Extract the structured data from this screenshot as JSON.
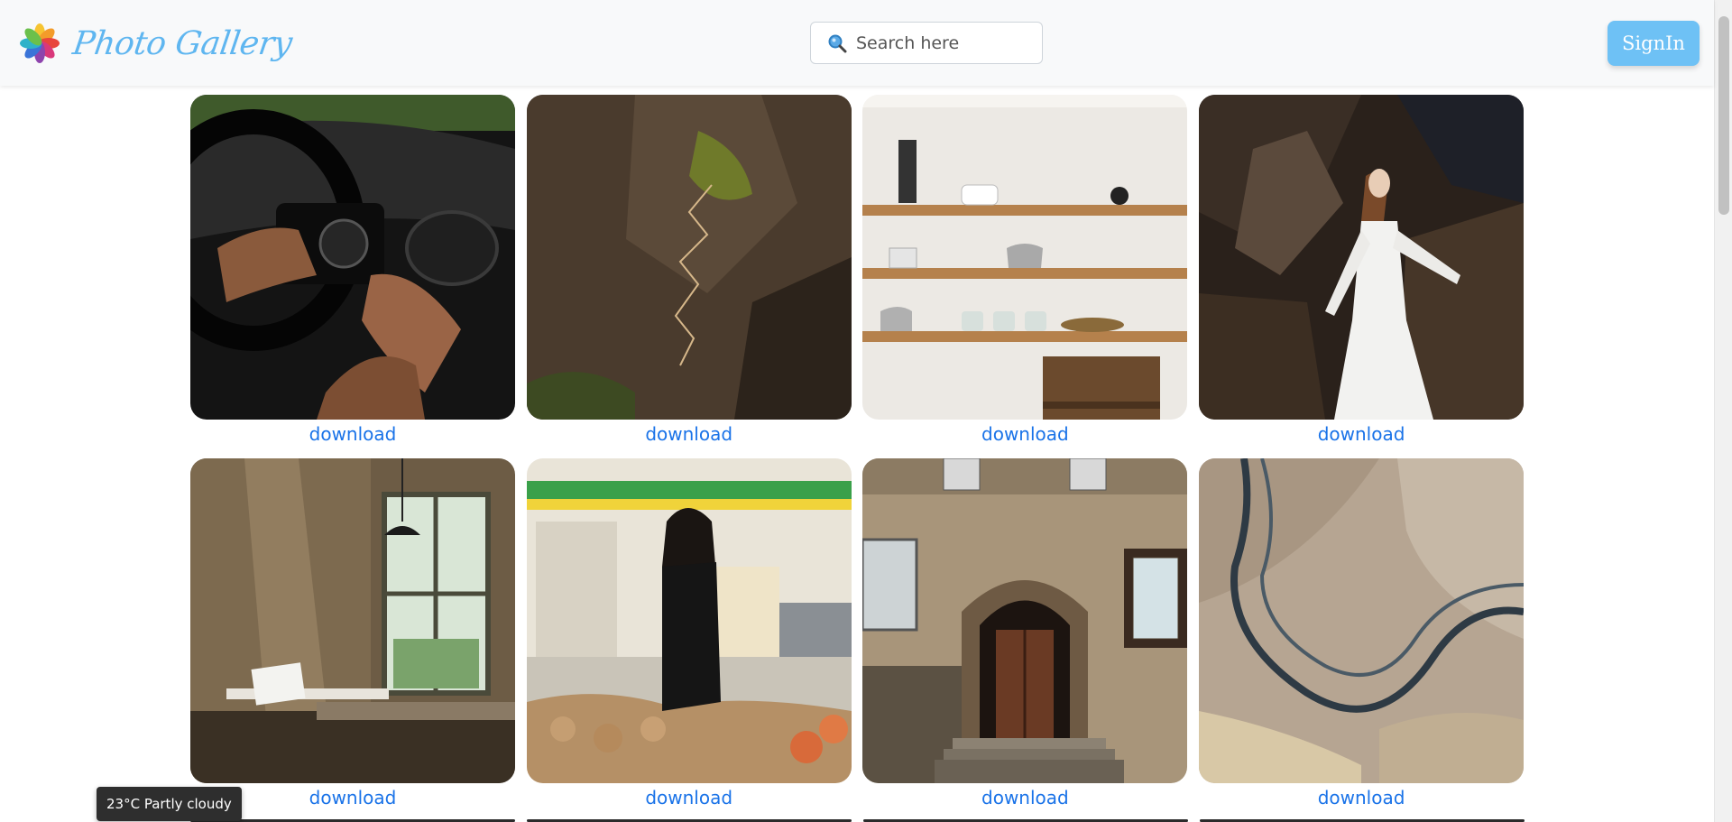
{
  "app": {
    "title": "Photo Gallery"
  },
  "search": {
    "placeholder": "Search here",
    "value": ""
  },
  "header": {
    "signin_label": "SignIn"
  },
  "gallery": {
    "items": [
      {
        "subject": "hands holding camera in car",
        "download_label": "download"
      },
      {
        "subject": "aerial rocky mountain with zigzag path",
        "download_label": "download"
      },
      {
        "subject": "kitchen shelves with kettles and jars",
        "download_label": "download"
      },
      {
        "subject": "woman in white dress on rocks",
        "download_label": "download"
      },
      {
        "subject": "sunlit room with window and pendant lamp",
        "download_label": "download"
      },
      {
        "subject": "woman in black in grocery store",
        "download_label": "download"
      },
      {
        "subject": "building doorway with shutters",
        "download_label": "download"
      },
      {
        "subject": "aerial view of stone texture river",
        "download_label": "download"
      }
    ]
  },
  "weather": {
    "text": "23°C Partly cloudy"
  },
  "colors": {
    "brand": "#5fb6f0",
    "signin": "#6ec1f5",
    "link": "#1a73e8",
    "header_bg": "#f8f9fa"
  }
}
